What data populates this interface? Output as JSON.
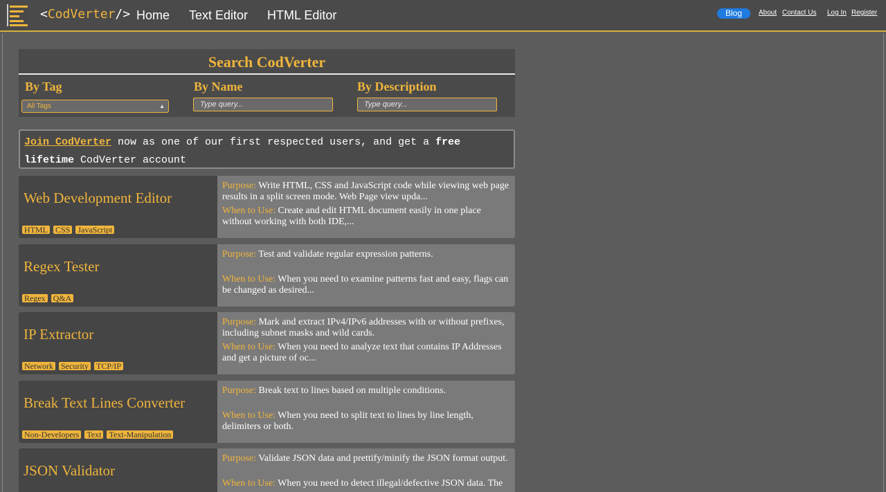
{
  "header": {
    "logo_left": "<",
    "logo_mid": "CodVerter",
    "logo_right": "/>",
    "nav": [
      "Home",
      "Text Editor",
      "HTML Editor"
    ],
    "blog": "Blog",
    "links": [
      "About",
      "Contact Us",
      "Log In",
      "Register"
    ]
  },
  "search": {
    "title": "Search CodVerter",
    "by_tag": "By Tag",
    "by_name": "By Name",
    "by_description": "By Description",
    "tag_select_value": "All Tags",
    "name_placeholder": "Type query...",
    "description_placeholder": "Type query..."
  },
  "join": {
    "link": "Join CodVerter",
    "text1": " now as one of our first respected users, and get a ",
    "bold1": "free",
    "bold2": "lifetime",
    "text2": " CodVerter account"
  },
  "labels": {
    "purpose": "Purpose:",
    "when": "When to Use:"
  },
  "tools": [
    {
      "name": "Web Development Editor",
      "tags": [
        "HTML",
        "CSS",
        "JavaScript"
      ],
      "purpose": "Write HTML, CSS and JavaScript code while viewing web page results in a split screen mode. Web Page view upda...",
      "when": "Create and edit HTML document easily in one place without working with both IDE,..."
    },
    {
      "name": "Regex Tester",
      "tags": [
        "Regex",
        "Q&A"
      ],
      "purpose": "Test and validate regular expression patterns.",
      "when": "When you need to examine patterns fast and easy, flags can be changed as desired..."
    },
    {
      "name": "IP Extractor",
      "tags": [
        "Network",
        "Security",
        "TCP/IP"
      ],
      "purpose": "Mark and extract IPv4/IPv6 addresses with or without prefixes, including subnet masks and wild cards.",
      "when": "When you need to analyze text that contains IP Addresses and get a picture of oc..."
    },
    {
      "name": "Break Text Lines Converter",
      "tags": [
        "Non-Developers",
        "Text",
        "Text-Manipulation"
      ],
      "purpose": "Break text to lines based on multiple conditions.",
      "when": "When you need to split text to lines by line length, delimiters or both."
    },
    {
      "name": "JSON Validator",
      "tags": [],
      "purpose": "Validate JSON data and prettify/minify the JSON format output.",
      "when": "When you need to detect illegal/defective JSON data. The"
    }
  ]
}
